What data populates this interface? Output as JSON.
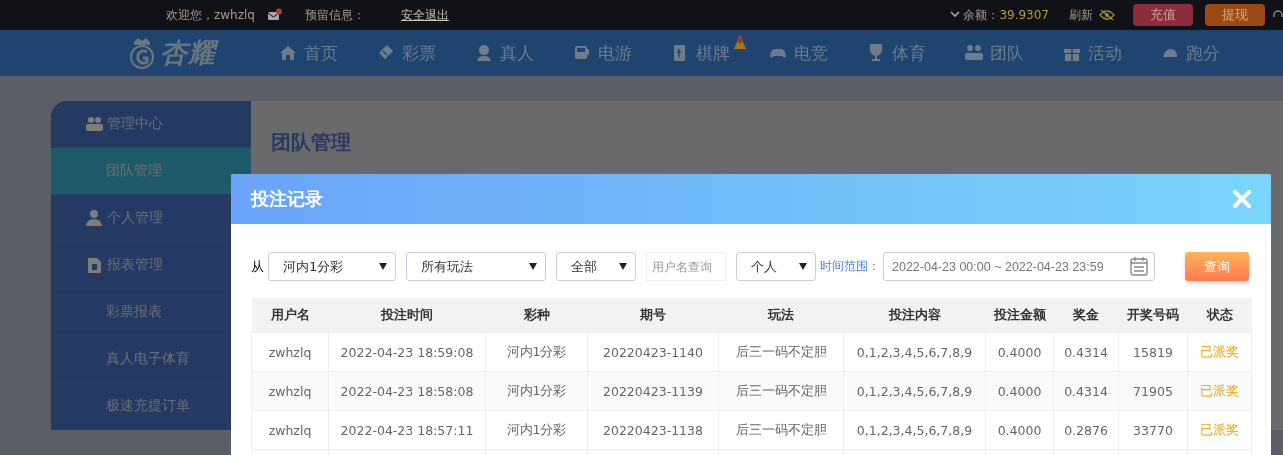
{
  "top_bar": {
    "greeting": "欢迎您，zwhzlq",
    "reserved_info_label": "预留信息：",
    "logout_link": "安全退出",
    "balance_label": "余额：",
    "balance_value": "39.9307",
    "refresh_label": "刷新",
    "buttons": [
      {
        "label": "充值",
        "kind": "deposit"
      },
      {
        "label": "提现",
        "kind": "withdraw"
      }
    ]
  },
  "nav": {
    "logo": "杏耀",
    "items": [
      {
        "label": "首页",
        "badge": false
      },
      {
        "label": "彩票",
        "badge": false
      },
      {
        "label": "真人",
        "badge": false
      },
      {
        "label": "电游",
        "badge": false
      },
      {
        "label": "棋牌",
        "badge": true
      },
      {
        "label": "电竞",
        "badge": false
      },
      {
        "label": "体育",
        "badge": false
      },
      {
        "label": "团队",
        "badge": false
      },
      {
        "label": "活动",
        "badge": false
      },
      {
        "label": "跑分",
        "badge": false
      }
    ]
  },
  "sidebar": {
    "items": [
      {
        "label": "管理中心",
        "kind": "group",
        "selected": false
      },
      {
        "label": "团队管理",
        "kind": "item",
        "selected": true
      },
      {
        "label": "个人管理",
        "kind": "group",
        "selected": false
      },
      {
        "label": "报表管理",
        "kind": "group",
        "selected": false
      },
      {
        "label": "彩票报表",
        "kind": "item",
        "selected": false
      },
      {
        "label": "真人电子体育",
        "kind": "item",
        "selected": false
      },
      {
        "label": "极速充提订单",
        "kind": "item",
        "selected": false
      }
    ]
  },
  "page_title": "团队管理",
  "modal": {
    "title": "投注记录",
    "filters": {
      "from_label": "从",
      "lottery": "河内1分彩",
      "play_type": "所有玩法",
      "status": "全部",
      "username": {
        "placeholder": "用户名查询"
      },
      "scope": "个人",
      "time_range_label": "时间范围：",
      "time_range": "2022-04-23 00:00 ~ 2022-04-23 23:59",
      "search_button": "查询"
    },
    "table": {
      "columns": [
        "用户名",
        "投注时间",
        "彩种",
        "期号",
        "玩法",
        "投注内容",
        "投注金额",
        "奖金",
        "开奖号码",
        "状态"
      ],
      "rows": [
        [
          "zwhzlq",
          "2022-04-23 18:59:08",
          "河内1分彩",
          "20220423-1140",
          "后三一码不定胆",
          "0,1,2,3,4,5,6,7,8,9",
          "0.4000",
          "0.4314",
          "15819",
          "已派奖"
        ],
        [
          "zwhzlq",
          "2022-04-23 18:58:08",
          "河内1分彩",
          "20220423-1139",
          "后三一码不定胆",
          "0,1,2,3,4,5,6,7,8,9",
          "0.4000",
          "0.4314",
          "71905",
          "已派奖"
        ],
        [
          "zwhzlq",
          "2022-04-23 18:57:11",
          "河内1分彩",
          "20220423-1138",
          "后三一码不定胆",
          "0,1,2,3,4,5,6,7,8,9",
          "0.4000",
          "0.2876",
          "33770",
          "已派奖"
        ]
      ]
    }
  }
}
